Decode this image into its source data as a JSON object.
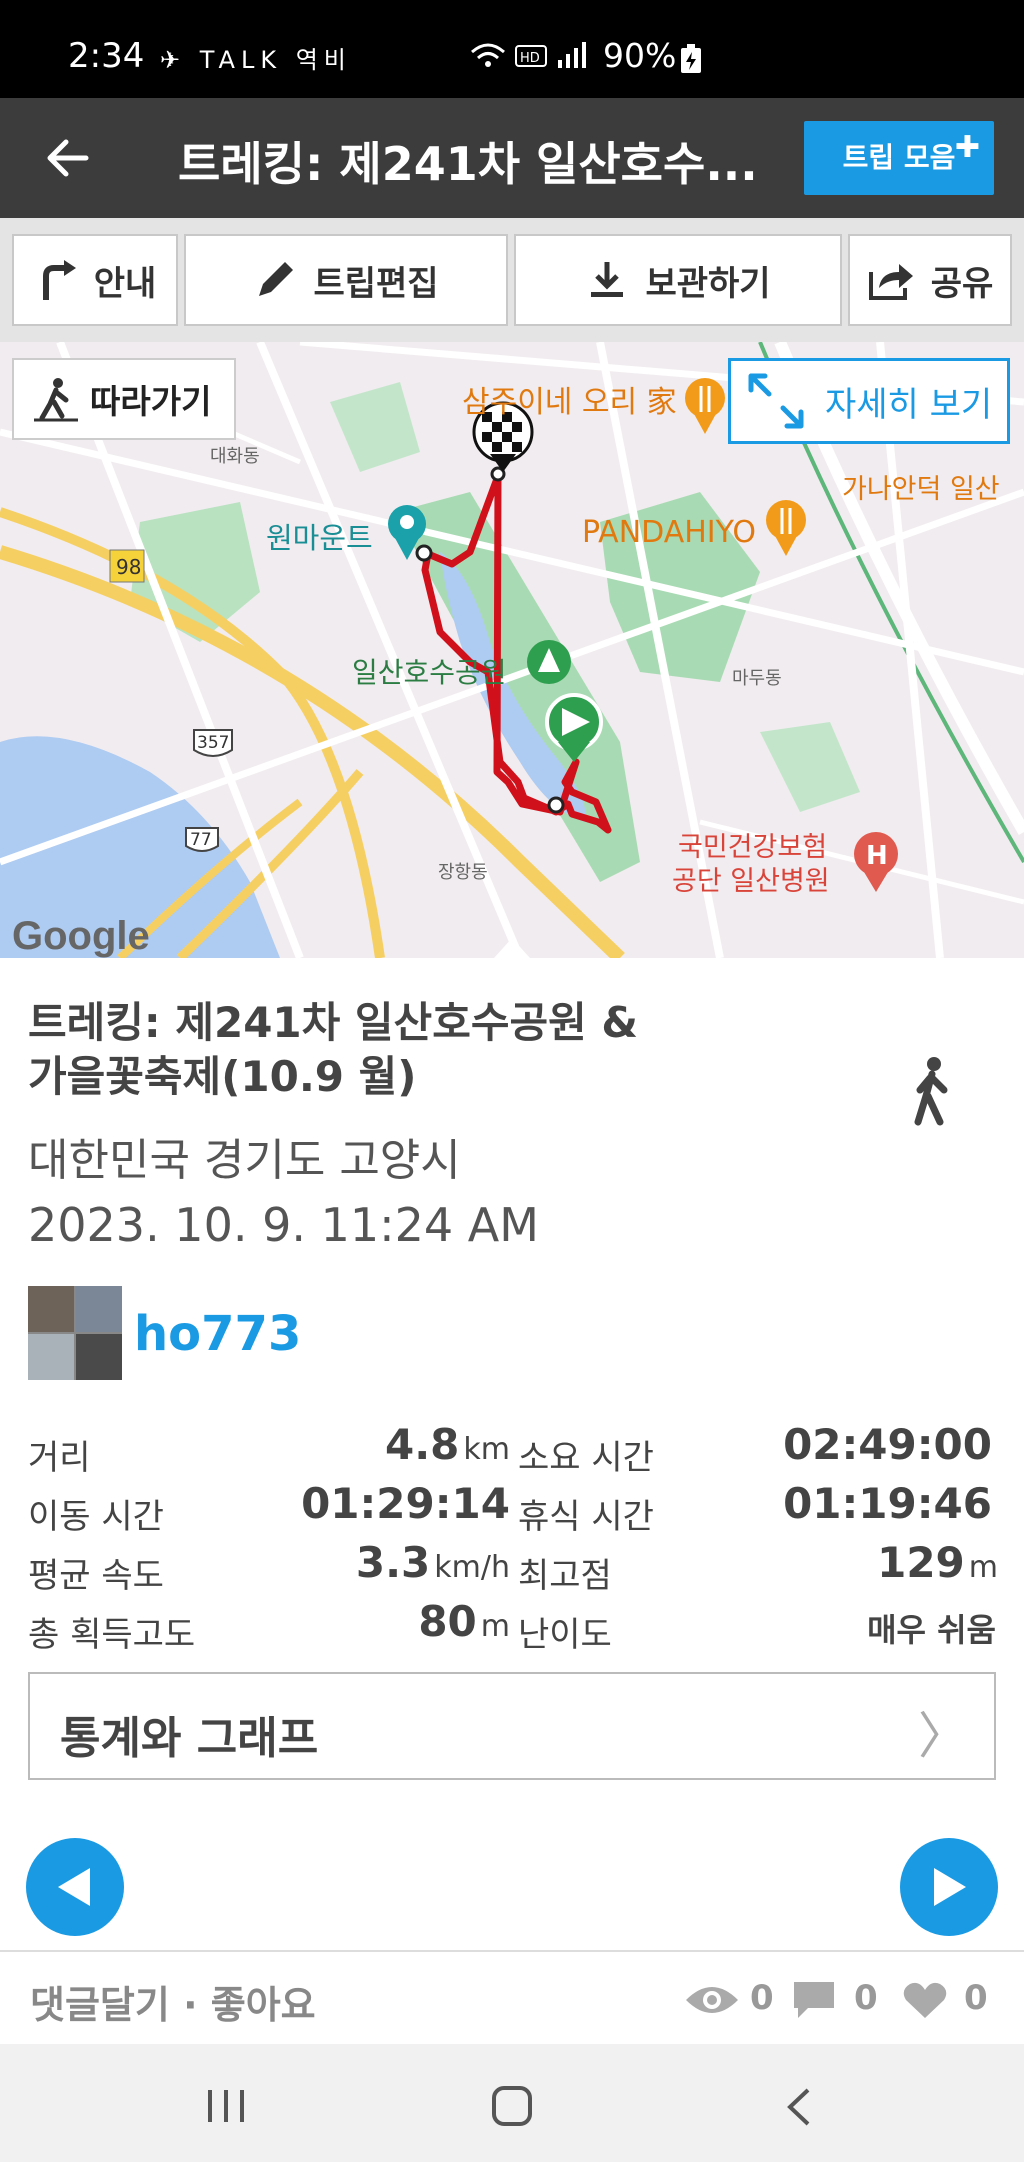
{
  "status": {
    "time": "2:34",
    "left_icons": "✈ TALK 역비",
    "battery": "90%"
  },
  "appbar": {
    "title": "트레킹: 제241차 일산호수...",
    "trip_button": "트립 모음"
  },
  "toolbar": {
    "guide": "안내",
    "edit": "트립편집",
    "save": "보관하기",
    "share": "공유"
  },
  "map": {
    "follow_label": "따라가기",
    "detail_label": "자세히 보기",
    "google": "Google",
    "labels": {
      "restaurant": "삼주이네 오리 家",
      "mountain": "원마운트",
      "pandahiyo": "PANDAHIYO",
      "park": "일산호수공원",
      "hospital1": "국민건강보험",
      "hospital2": "공단 일산병원",
      "ganaan": "가나안덕 일산",
      "madu": "마두동",
      "daehwa": "대화동",
      "janghang": "장항동",
      "route98": "98",
      "route357": "357",
      "route77": "77"
    }
  },
  "trip": {
    "name_line1": "트레킹: 제241차 일산호수공원 &",
    "name_line2": "가을꽃축제(10.9 월)",
    "location": "대한민국 경기도 고양시",
    "date": "2023. 10. 9. 11:24 AM",
    "user": "ho773"
  },
  "stats": {
    "distance_label": "거리",
    "distance_value": "4.8",
    "distance_unit": "km",
    "duration_label": "소요 시간",
    "duration_value": "02:49:00",
    "moving_label": "이동 시간",
    "moving_value": "01:29:14",
    "rest_label": "휴식 시간",
    "rest_value": "01:19:46",
    "speed_label": "평균 속도",
    "speed_value": "3.3",
    "speed_unit": "km/h",
    "max_elev_label": "최고점",
    "max_elev_value": "129",
    "max_elev_unit": "m",
    "gain_label": "총 획득고도",
    "gain_value": "80",
    "gain_unit": "m",
    "difficulty_label": "난이도",
    "difficulty_value": "매우 쉬움"
  },
  "graph_button": "통계와 그래프",
  "footer": {
    "comment_like": "댓글달기 · 좋아요",
    "views": "0",
    "comments": "0",
    "likes": "0"
  },
  "colors": {
    "accent": "#1b9ae4",
    "route": "#d0111b",
    "appbar": "#3c3c3c"
  }
}
